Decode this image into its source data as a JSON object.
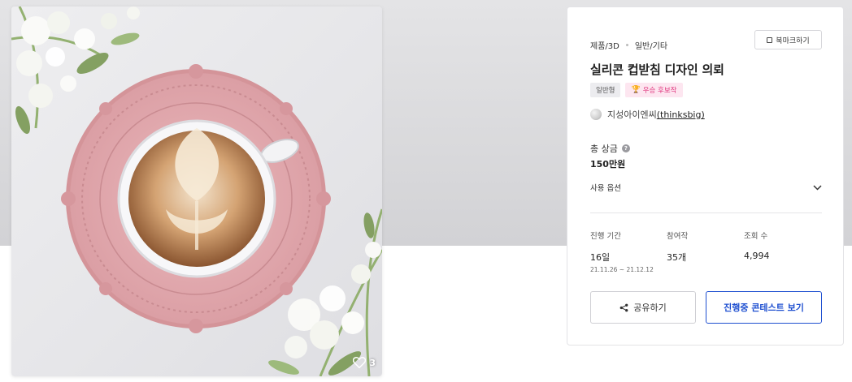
{
  "image": {
    "alt": "",
    "icon": "heart-icon",
    "likes": "3"
  },
  "panel": {
    "breadcrumb": [
      "제품/3D",
      "일반/기타"
    ],
    "bookmark_label": "북마크하기",
    "title": "실리콘 컵받침 디자인 의뢰",
    "tags": {
      "type": "일반형",
      "award_icon": "trophy-icon",
      "award": "우승 후보작"
    },
    "author": {
      "name": "지성아이엔씨",
      "handle": "(thinksbig)"
    },
    "prize": {
      "label": "총 상금",
      "value": "150만원"
    },
    "usage_label": "사용 옵션",
    "stats": {
      "period": {
        "label": "진행 기간",
        "value": "16일",
        "range": "21.11.26 ~ 21.12.12"
      },
      "entries": {
        "label": "참여작",
        "value": "35개"
      },
      "views": {
        "label": "조회 수",
        "value": "4,994"
      }
    },
    "share_label": "공유하기",
    "contest_label": "진행중 콘테스트 보기"
  },
  "colors": {
    "accent": "#1e4fd0",
    "award_pink": "#e0367e",
    "coaster_pink": "#e2a9ae"
  }
}
